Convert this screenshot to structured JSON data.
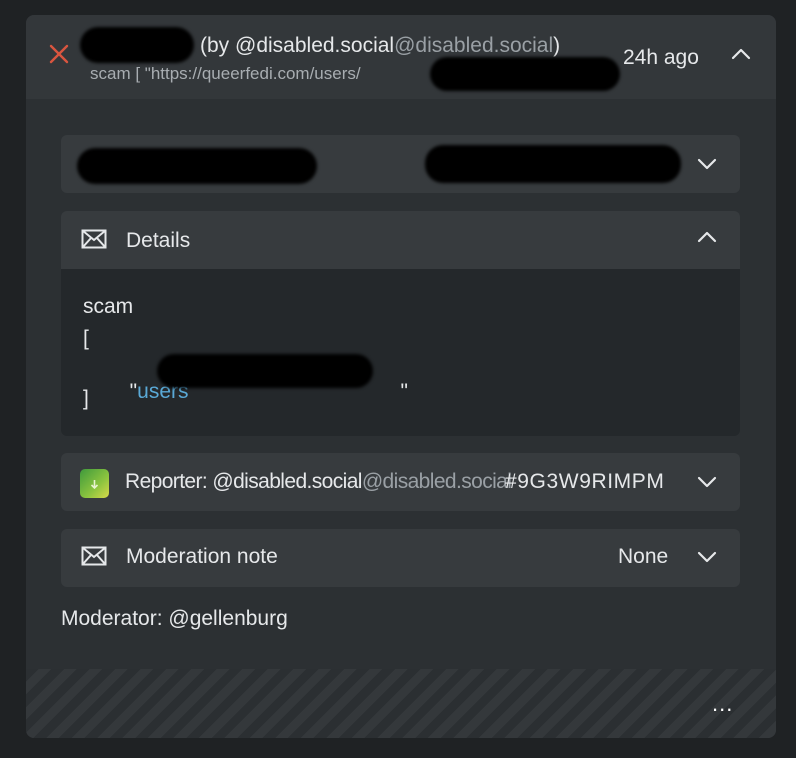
{
  "report": {
    "handle_prefix": "(by @disabled.social",
    "handle_domain": "@disabled.social",
    "handle_suffix": ")",
    "comment_preview": "scam [ \"https://queerfedi.com/users/",
    "time_ago": "24h ago"
  },
  "details": {
    "title": "Details",
    "line1": "scam",
    "line2": "[",
    "line3_prefix": "  \"",
    "line3_link": "users",
    "line3_suffix": "\"",
    "line4": "]"
  },
  "reporter": {
    "label": "Reporter: @disabled.social",
    "domain": "@disabled.social",
    "id": "#9G3W9RIMPM"
  },
  "moderation_note": {
    "title": "Moderation note",
    "value": "None"
  },
  "moderator": "Moderator: @gellenburg",
  "footer": {
    "more_label": "..."
  },
  "colors": {
    "close_icon": "#d9553f",
    "link": "#5aa9d6",
    "card_background": "#2c3033"
  },
  "icons": {
    "close": "close-icon",
    "expand": "chevron-down-icon",
    "collapse": "chevron-up-icon",
    "details": "mail-icon",
    "moderation_note": "mail-icon"
  }
}
